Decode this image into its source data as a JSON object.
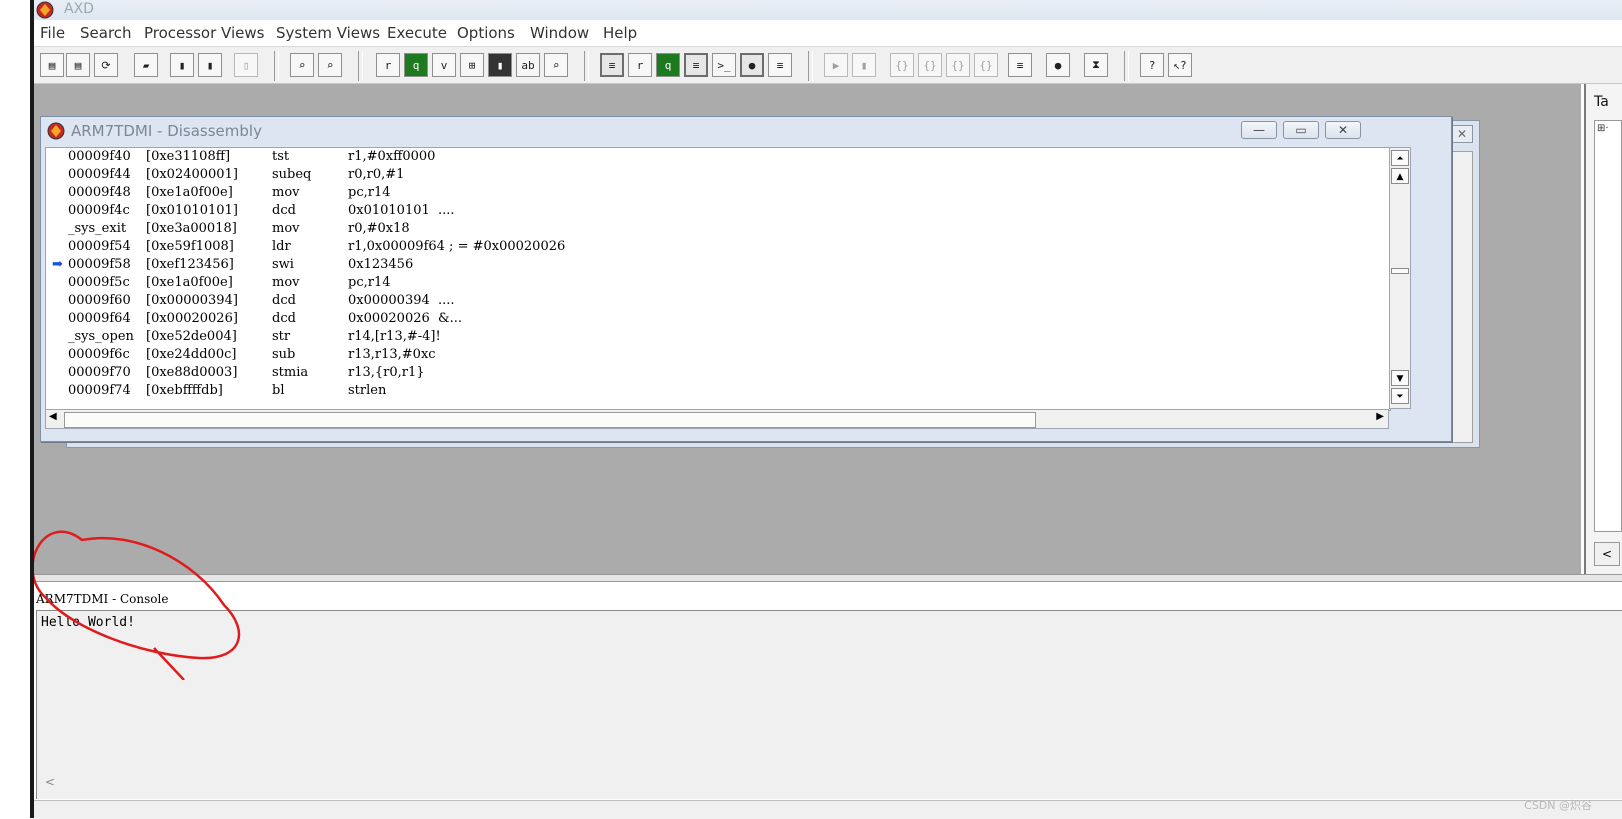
{
  "app": {
    "title": "AXD"
  },
  "menu": [
    "File",
    "Search",
    "Processor Views",
    "System Views",
    "Execute",
    "Options",
    "Window",
    "Help"
  ],
  "disassembly": {
    "window_title": "ARM7TDMI - Disassembly",
    "current_line_index": 6,
    "rows": [
      {
        "addr": "00009f40",
        "code": "[0xe31108ff]",
        "op": "tst",
        "args": "r1,#0xff0000"
      },
      {
        "addr": "00009f44",
        "code": "[0x02400001]",
        "op": "subeq",
        "args": "r0,r0,#1"
      },
      {
        "addr": "00009f48",
        "code": "[0xe1a0f00e]",
        "op": "mov",
        "args": "pc,r14"
      },
      {
        "addr": "00009f4c",
        "code": "[0x01010101]",
        "op": "dcd",
        "args": "0x01010101  ...."
      },
      {
        "addr": "_sys_exit",
        "code": "[0xe3a00018]",
        "op": "mov",
        "args": "r0,#0x18"
      },
      {
        "addr": "00009f54",
        "code": "[0xe59f1008]",
        "op": "ldr",
        "args": "r1,0x00009f64 ; = #0x00020026"
      },
      {
        "addr": "00009f58",
        "code": "[0xef123456]",
        "op": "swi",
        "args": "0x123456"
      },
      {
        "addr": "00009f5c",
        "code": "[0xe1a0f00e]",
        "op": "mov",
        "args": "pc,r14"
      },
      {
        "addr": "00009f60",
        "code": "[0x00000394]",
        "op": "dcd",
        "args": "0x00000394  ...."
      },
      {
        "addr": "00009f64",
        "code": "[0x00020026]",
        "op": "dcd",
        "args": "0x00020026  &..."
      },
      {
        "addr": "_sys_open",
        "code": "[0xe52de004]",
        "op": "str",
        "args": "r14,[r13,#-4]!"
      },
      {
        "addr": "00009f6c",
        "code": "[0xe24dd00c]",
        "op": "sub",
        "args": "r13,r13,#0xc"
      },
      {
        "addr": "00009f70",
        "code": "[0xe88d0003]",
        "op": "stmia",
        "args": "r13,{r0,r1}"
      },
      {
        "addr": "00009f74",
        "code": "[0xebffffdb]",
        "op": "bl",
        "args": "strlen"
      }
    ]
  },
  "right_panel": {
    "tab_label": "Ta",
    "tree_marker": "⊞·"
  },
  "console": {
    "title": "ARM7TDMI - Console",
    "output": "Hello World!"
  },
  "watermark": "CSDN @炽谷",
  "colors": {
    "annotation": "#e01b1b",
    "current_line_arrow": "#1a55d6"
  }
}
